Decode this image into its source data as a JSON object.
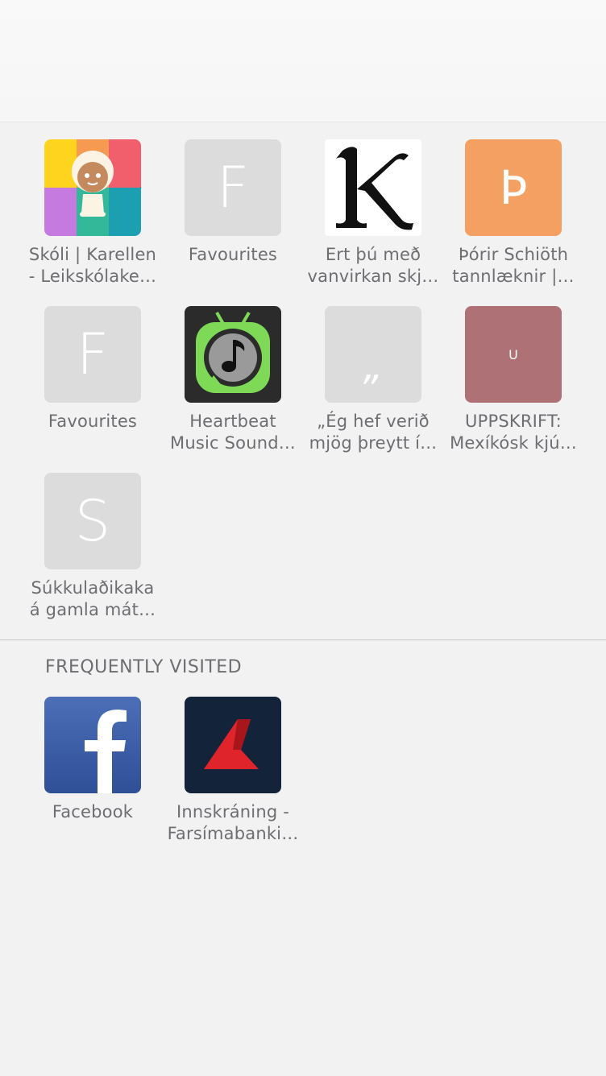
{
  "favorites": [
    {
      "icon": "karellen-kid-icon",
      "line1": "Skóli | Karellen",
      "line2": "- Leikskólake…"
    },
    {
      "icon": "letter-f-icon",
      "letter": "F",
      "line1": "Favourites",
      "line2": ""
    },
    {
      "icon": "k-logo-icon",
      "line1": "Ert þú með",
      "line2": "vanvirkan skj…"
    },
    {
      "icon": "letter-thorn-icon",
      "letter": "Þ",
      "line1": "Þórir Schiöth",
      "line2": "tannlæknir |…"
    },
    {
      "icon": "letter-f-icon",
      "letter": "F",
      "line1": "Favourites",
      "line2": ""
    },
    {
      "icon": "music-tv-icon",
      "line1": "Heartbeat",
      "line2": "Music Sound…"
    },
    {
      "icon": "quote-mark-icon",
      "letter": "„",
      "line1": "„Ég hef verið",
      "line2": "mjög þreytt í…"
    },
    {
      "icon": "letter-u-icon",
      "letter": "U",
      "line1": "UPPSKRIFT:",
      "line2": "Mexíkósk kjú…"
    },
    {
      "icon": "letter-s-icon",
      "letter": "S",
      "line1": "Súkkulaðikaka",
      "line2": "á gamla mát…"
    }
  ],
  "frequently_visited": {
    "title": "FREQUENTLY VISITED",
    "items": [
      {
        "icon": "facebook-icon",
        "line1": "Facebook",
        "line2": ""
      },
      {
        "icon": "bank-logo-icon",
        "line1": "Innskráning -",
        "line2": "Farsímabanki…"
      }
    ]
  },
  "colors": {
    "thorn_tile": "#f4a062",
    "u_tile": "#ae7176",
    "letter_tile": "#dcdcdc"
  }
}
